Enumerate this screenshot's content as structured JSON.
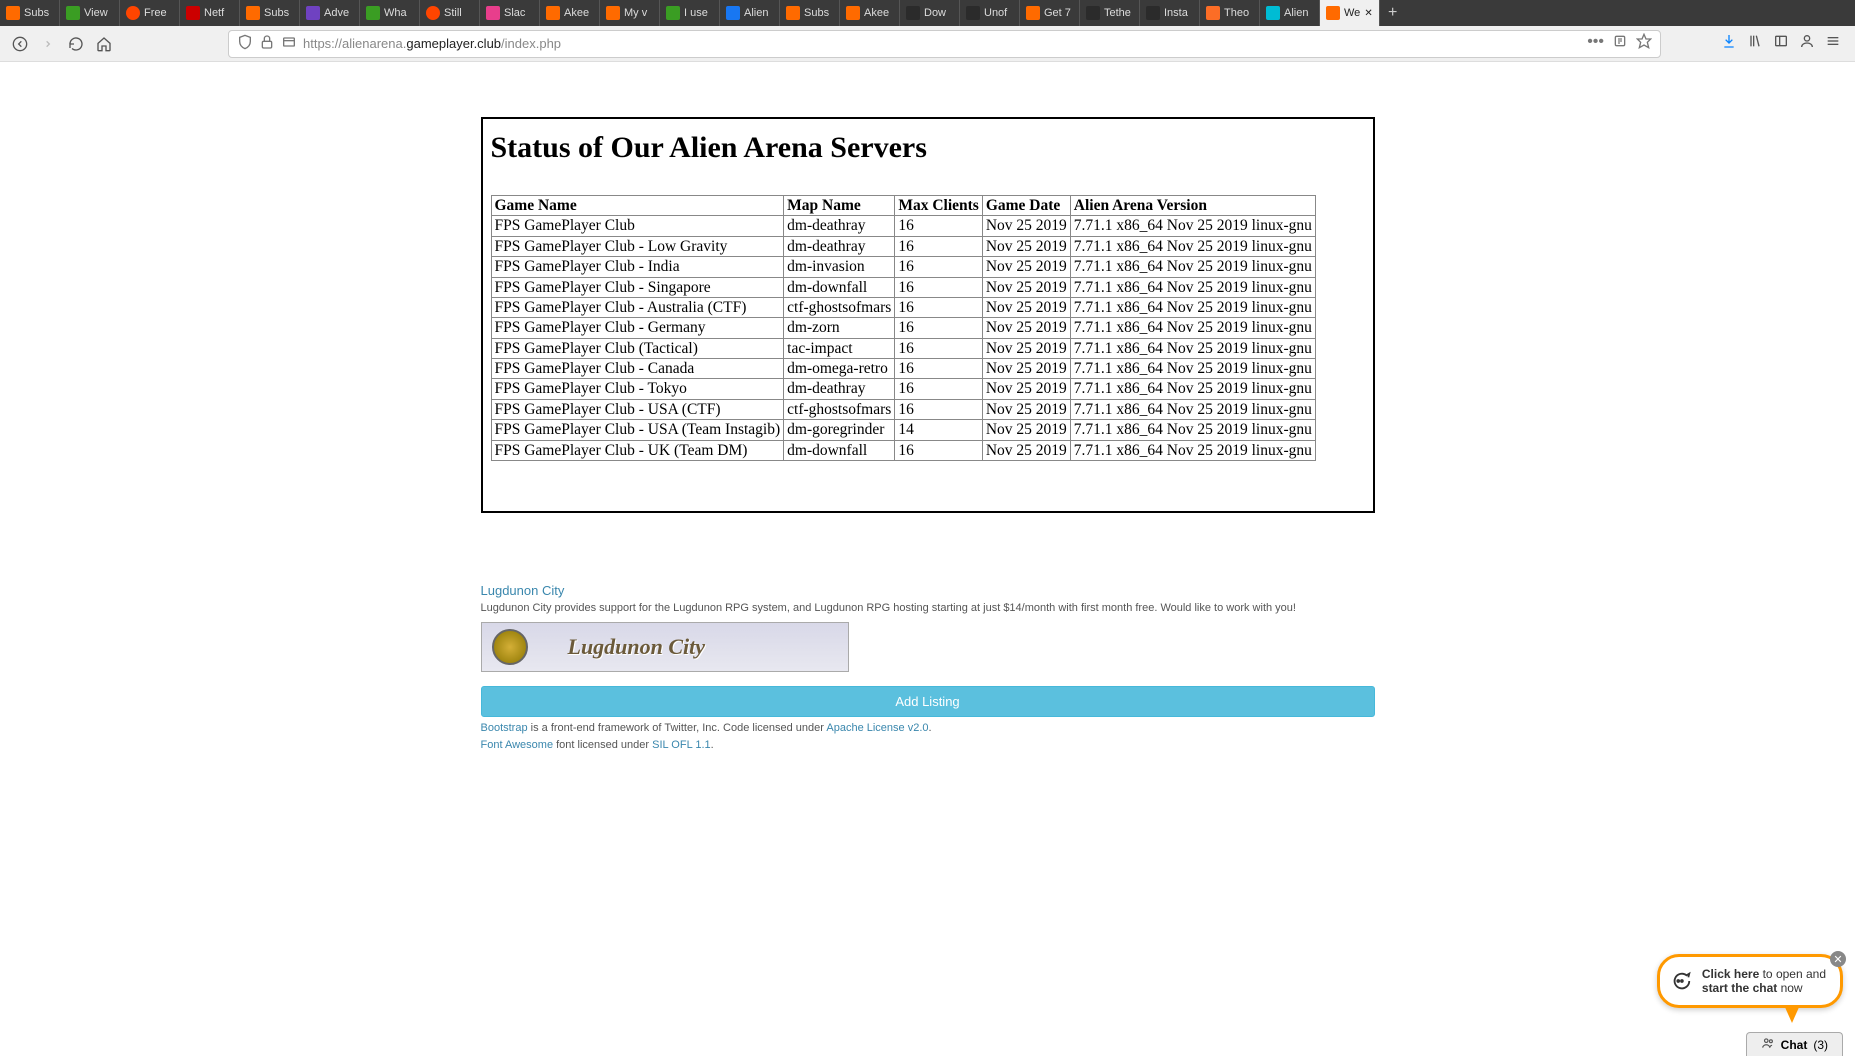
{
  "browser": {
    "tabs": [
      {
        "label": "Subs",
        "favicon": "favicon-orange"
      },
      {
        "label": "View",
        "favicon": "favicon-green"
      },
      {
        "label": "Free",
        "favicon": "favicon-reddit"
      },
      {
        "label": "Netf",
        "favicon": "favicon-red"
      },
      {
        "label": "Subs",
        "favicon": "favicon-orange"
      },
      {
        "label": "Adve",
        "favicon": "favicon-purple"
      },
      {
        "label": "Wha",
        "favicon": "favicon-green"
      },
      {
        "label": "Still ",
        "favicon": "favicon-reddit"
      },
      {
        "label": "Slac",
        "favicon": "favicon-pink"
      },
      {
        "label": "Akee",
        "favicon": "favicon-orange"
      },
      {
        "label": "My v",
        "favicon": "favicon-orange"
      },
      {
        "label": "I use",
        "favicon": "favicon-green"
      },
      {
        "label": "Alien",
        "favicon": "favicon-blue"
      },
      {
        "label": "Subs",
        "favicon": "favicon-orange"
      },
      {
        "label": "Akee",
        "favicon": "favicon-orange"
      },
      {
        "label": "Dow",
        "favicon": "favicon-dark"
      },
      {
        "label": "Unof",
        "favicon": "favicon-dark"
      },
      {
        "label": "Get 7",
        "favicon": "favicon-orange"
      },
      {
        "label": "Tethe",
        "favicon": "favicon-dark"
      },
      {
        "label": "Insta",
        "favicon": "favicon-dark"
      },
      {
        "label": "Theo",
        "favicon": "favicon-gitlab"
      },
      {
        "label": "Alien",
        "favicon": "favicon-cyan"
      },
      {
        "label": "We",
        "favicon": "favicon-orange",
        "active": true
      }
    ],
    "url_prefix": "https://alienarena.",
    "url_domain": "gameplayer.club",
    "url_suffix": "/index.php"
  },
  "page_title": "Status of Our Alien Arena Servers",
  "table": {
    "headers": [
      "Game Name",
      "Map Name",
      "Max Clients",
      "Game Date",
      "Alien Arena Version"
    ],
    "rows": [
      [
        "FPS GamePlayer Club",
        "dm-deathray",
        "16",
        "Nov 25 2019",
        "7.71.1 x86_64 Nov 25 2019 linux-gnu"
      ],
      [
        "FPS GamePlayer Club - Low Gravity",
        "dm-deathray",
        "16",
        "Nov 25 2019",
        "7.71.1 x86_64 Nov 25 2019 linux-gnu"
      ],
      [
        "FPS GamePlayer Club - India",
        "dm-invasion",
        "16",
        "Nov 25 2019",
        "7.71.1 x86_64 Nov 25 2019 linux-gnu"
      ],
      [
        "FPS GamePlayer Club - Singapore",
        "dm-downfall",
        "16",
        "Nov 25 2019",
        "7.71.1 x86_64 Nov 25 2019 linux-gnu"
      ],
      [
        "FPS GamePlayer Club - Australia (CTF)",
        "ctf-ghostsofmars",
        "16",
        "Nov 25 2019",
        "7.71.1 x86_64 Nov 25 2019 linux-gnu"
      ],
      [
        "FPS GamePlayer Club - Germany",
        "dm-zorn",
        "16",
        "Nov 25 2019",
        "7.71.1 x86_64 Nov 25 2019 linux-gnu"
      ],
      [
        "FPS GamePlayer Club (Tactical)",
        "tac-impact",
        "16",
        "Nov 25 2019",
        "7.71.1 x86_64 Nov 25 2019 linux-gnu"
      ],
      [
        "FPS GamePlayer Club - Canada",
        "dm-omega-retro",
        "16",
        "Nov 25 2019",
        "7.71.1 x86_64 Nov 25 2019 linux-gnu"
      ],
      [
        "FPS GamePlayer Club - Tokyo",
        "dm-deathray",
        "16",
        "Nov 25 2019",
        "7.71.1 x86_64 Nov 25 2019 linux-gnu"
      ],
      [
        "FPS GamePlayer Club - USA (CTF)",
        "ctf-ghostsofmars",
        "16",
        "Nov 25 2019",
        "7.71.1 x86_64 Nov 25 2019 linux-gnu"
      ],
      [
        "FPS GamePlayer Club - USA (Team Instagib)",
        "dm-goregrinder",
        "14",
        "Nov 25 2019",
        "7.71.1 x86_64 Nov 25 2019 linux-gnu"
      ],
      [
        "FPS GamePlayer Club - UK (Team DM)",
        "dm-downfall",
        "16",
        "Nov 25 2019",
        "7.71.1 x86_64 Nov 25 2019 linux-gnu"
      ]
    ]
  },
  "footer": {
    "lugdunon_title": "Lugdunon City",
    "lugdunon_desc": "Lugdunon City provides support for the Lugdunon RPG system, and Lugdunon RPG hosting starting at just $14/month with first month free. Would like to work with you!",
    "banner_text": "Lugdunon City",
    "add_listing": "Add Listing",
    "bootstrap_link": "Bootstrap",
    "bootstrap_text": " is a front-end framework of Twitter, Inc. Code licensed under ",
    "apache_link": "Apache License v2.0",
    "fontawesome_link": "Font Awesome",
    "fontawesome_text": " font licensed under ",
    "sil_link": "SIL OFL 1.1"
  },
  "chat": {
    "click_here": "Click here",
    "line1_rest": " to open and",
    "line2_bold": "start the chat",
    "line2_rest": " now",
    "tab_label": "Chat",
    "tab_count": "(3)"
  }
}
